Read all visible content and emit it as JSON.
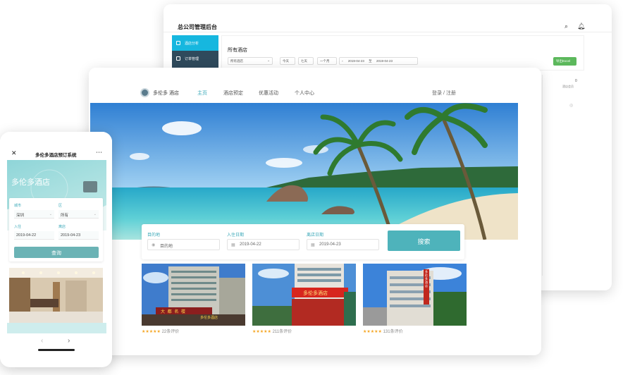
{
  "admin": {
    "title": "总公司管理后台",
    "sidebar": [
      {
        "label": "酒店分析",
        "active": true
      },
      {
        "label": "订单管理",
        "active": false
      }
    ],
    "section_title": "所有酒店",
    "filter_select": "所有酒店",
    "quick_ranges": [
      "今天",
      "七天",
      "一个月"
    ],
    "date_start": "2019-04-23",
    "date_sep": "至",
    "date_end": "2019-04-23",
    "export_label": "导出Excel",
    "stat_value": "0",
    "stat_label": "酒店会员"
  },
  "web": {
    "brand": "多伦多 酒店",
    "nav": [
      "主页",
      "酒店预定",
      "优惠活动",
      "个人中心"
    ],
    "active_nav": "主页",
    "auth": "登录 / 注册",
    "search": {
      "destination_label": "目的地",
      "destination_placeholder": "目的地",
      "checkin_label": "入住日期",
      "checkin_value": "2019-04-22",
      "checkout_label": "离店日期",
      "checkout_value": "2019-04-23",
      "button": "搜索"
    },
    "hotels": [
      {
        "stars": "★★★★★",
        "reviews": "22条评价"
      },
      {
        "stars": "★★★★★",
        "reviews": "211条评价"
      },
      {
        "stars": "★★★★★",
        "reviews": "131条评价"
      }
    ],
    "signs": {
      "sign1": "大 都 名 楼",
      "sign2": "多伦多酒店",
      "sign3": "多伦多酒店",
      "sign3_vertical": "多伦多酒店"
    }
  },
  "mobile": {
    "title": "多伦多酒店预订系统",
    "hero_text": "多伦多酒店",
    "city_label": "城市",
    "city_value": "深圳",
    "area_label": "区",
    "area_value": "所有",
    "checkin_label": "入住",
    "checkin_value": "2019-04-22",
    "checkout_label": "离店",
    "checkout_value": "2019-04-23",
    "query_button": "查询"
  }
}
